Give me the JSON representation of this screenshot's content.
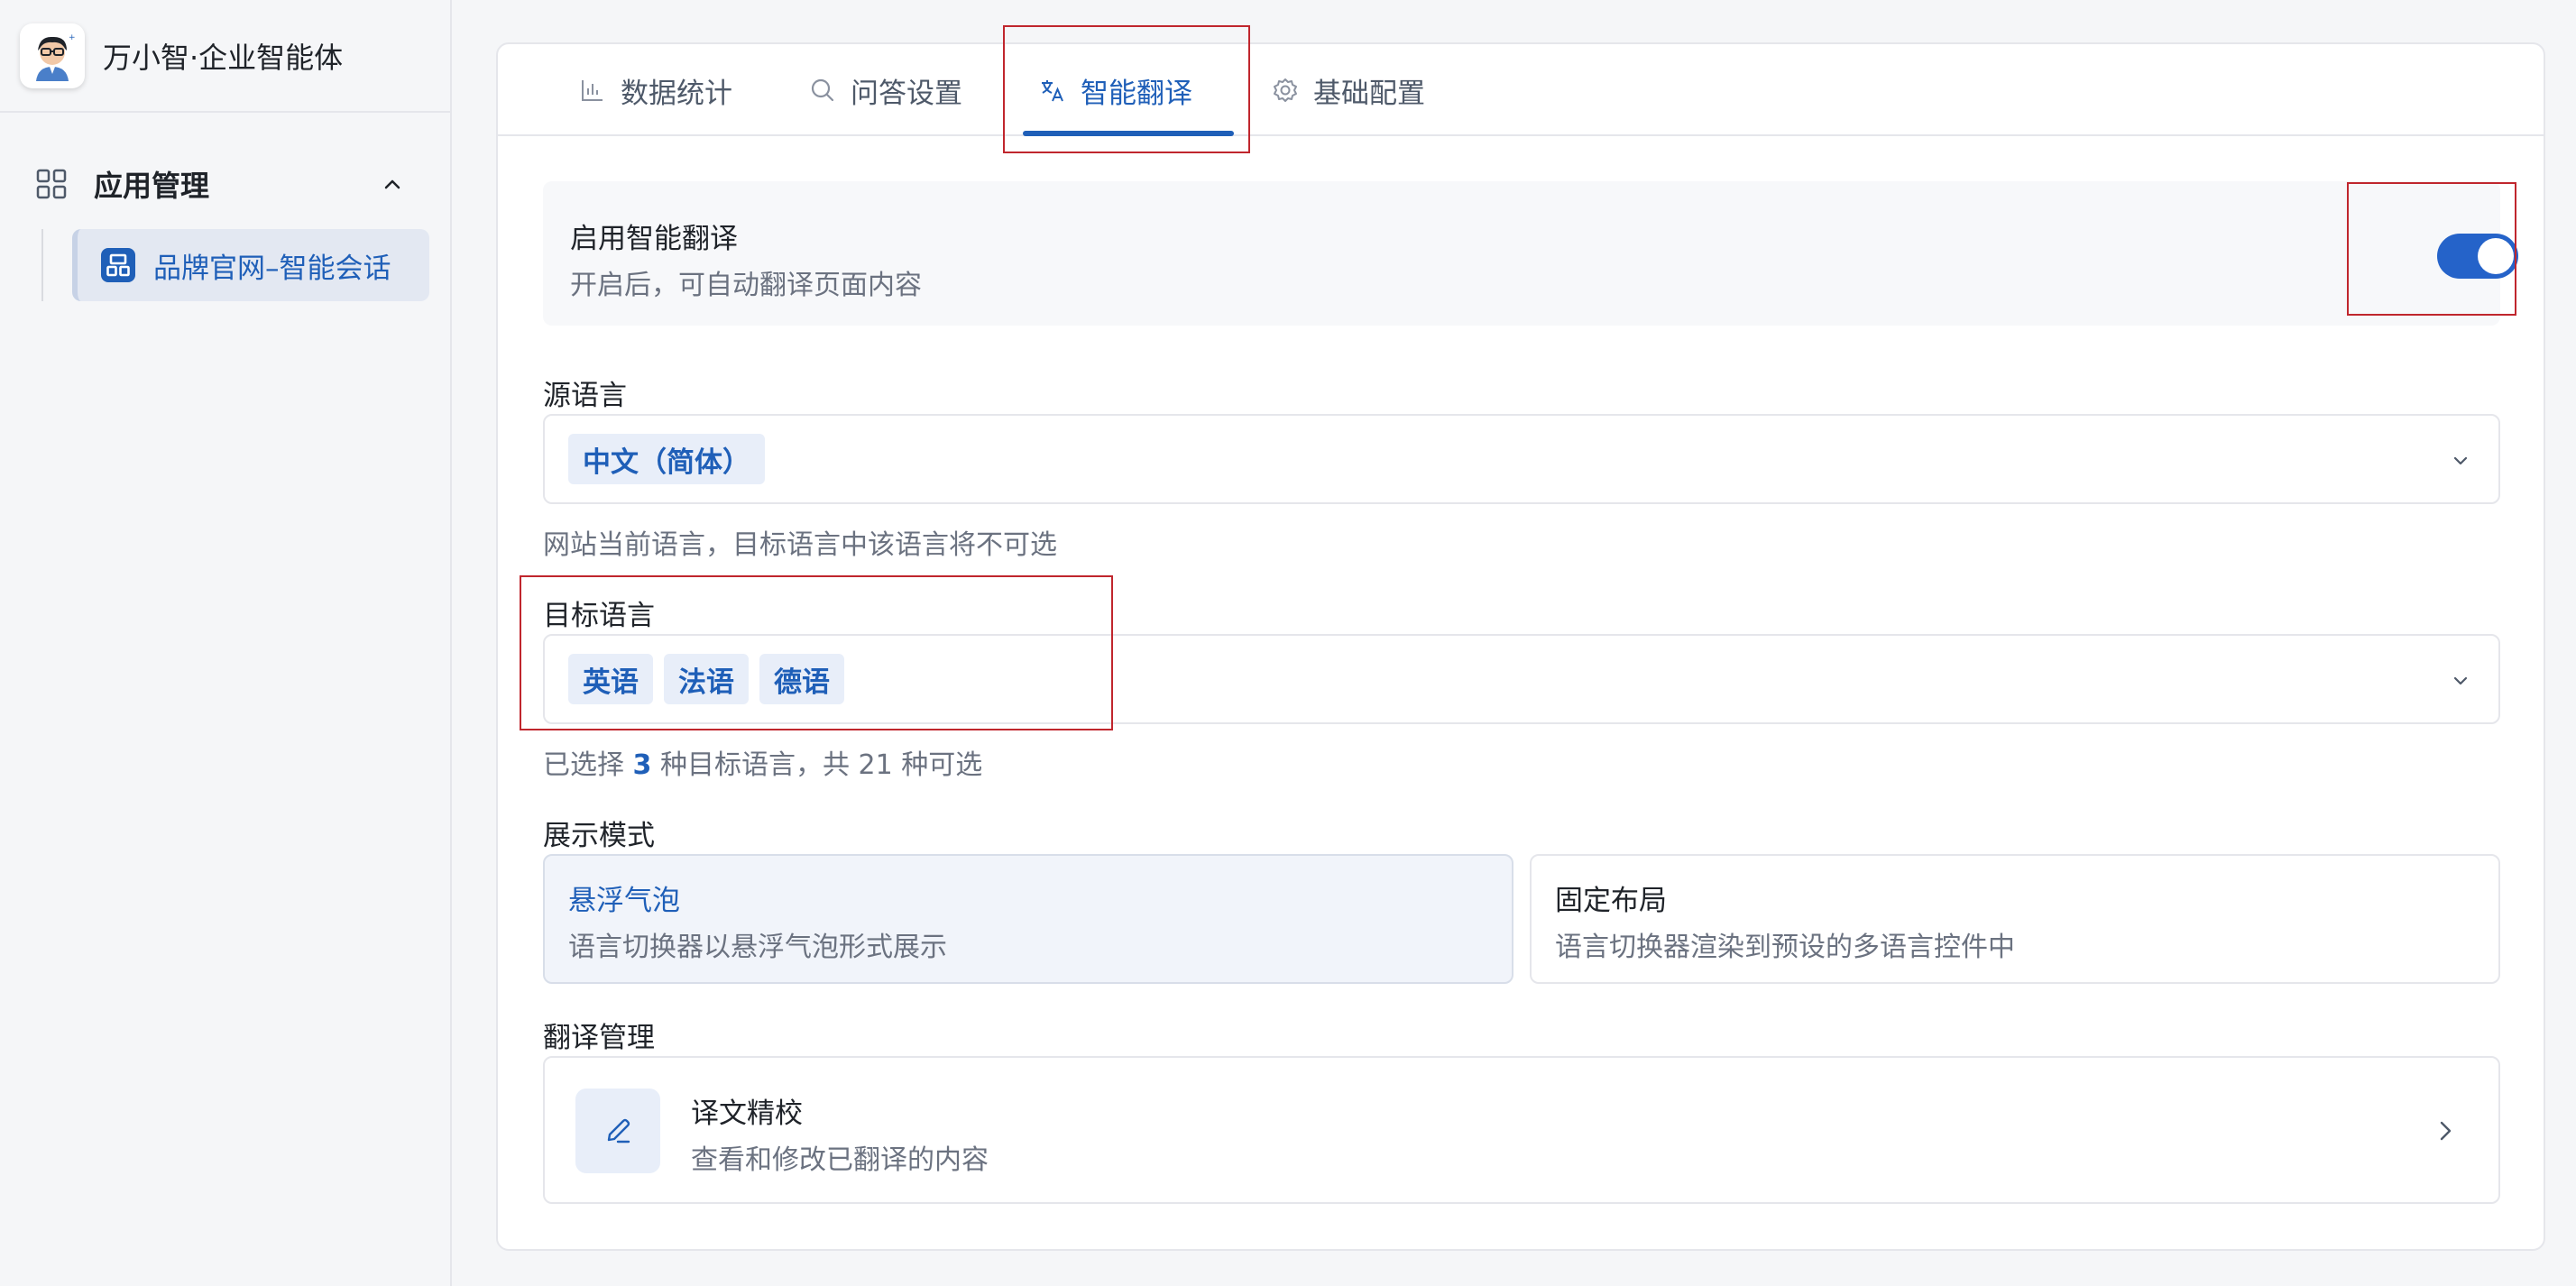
{
  "app": {
    "brand_name": "万小智·企业智能体"
  },
  "sidebar": {
    "group_label": "应用管理",
    "items": [
      {
        "label": "品牌官网–智能会话",
        "active": true
      }
    ]
  },
  "tabs": [
    {
      "label": "数据统计",
      "icon": "bar-chart-icon",
      "active": false
    },
    {
      "label": "问答设置",
      "icon": "search-icon",
      "active": false
    },
    {
      "label": "智能翻译",
      "icon": "translate-icon",
      "active": true
    },
    {
      "label": "基础配置",
      "icon": "gear-icon",
      "active": false
    }
  ],
  "translation": {
    "enable_title": "启用智能翻译",
    "enable_desc": "开启后，可自动翻译页面内容",
    "enabled": true,
    "source_label": "源语言",
    "source_value": "中文（简体）",
    "source_hint": "网站当前语言，目标语言中该语言将不可选",
    "target_label": "目标语言",
    "target_values": [
      "英语",
      "法语",
      "德语"
    ],
    "target_hint_prefix": "已选择",
    "target_count": "3",
    "target_hint_suffix": "种目标语言，共 21 种可选",
    "display_label": "展示模式",
    "display_modes": [
      {
        "title": "悬浮气泡",
        "desc": "语言切换器以悬浮气泡形式展示",
        "selected": true
      },
      {
        "title": "固定布局",
        "desc": "语言切换器渲染到预设的多语言控件中",
        "selected": false
      }
    ],
    "manage_label": "翻译管理",
    "manage_title": "译文精校",
    "manage_desc": "查看和修改已翻译的内容"
  },
  "colors": {
    "accent": "#1f5fb8",
    "toggle_on": "#2563c9",
    "annotation": "#c0262d"
  }
}
